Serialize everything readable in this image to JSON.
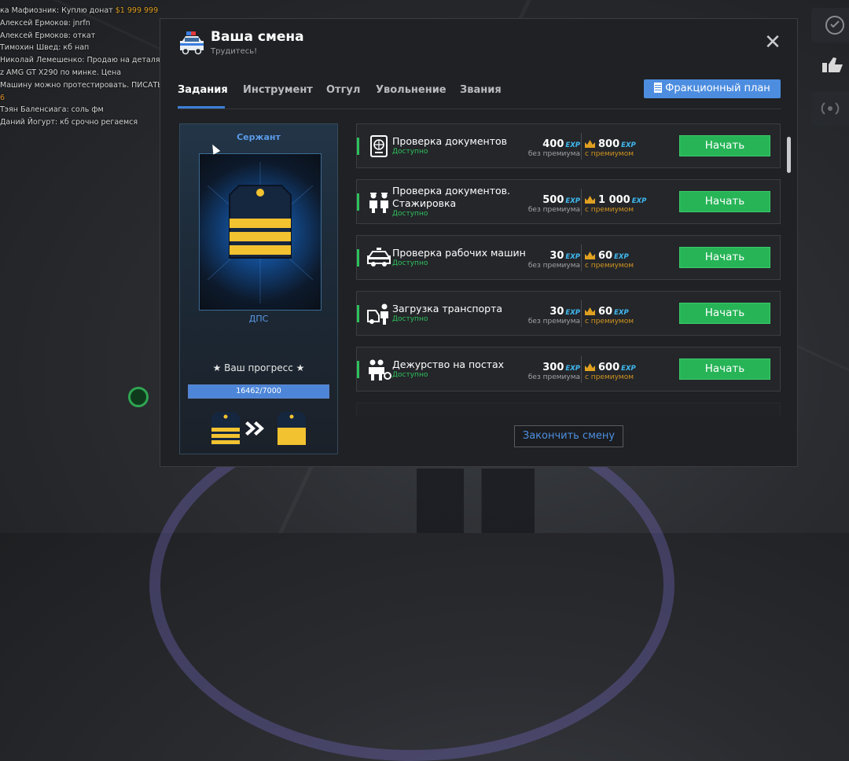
{
  "chat": [
    {
      "prefix": "ка Мафиозник: Куплю донат ",
      "money": "$1 999 999",
      "style": "normal"
    },
    {
      "prefix": "Алексей Ермоков: jnrfn",
      "money": "",
      "style": "normal"
    },
    {
      "prefix": "Алексей Ермоков: откат",
      "money": "",
      "style": "normal"
    },
    {
      "prefix": "Тимохин Швед: кб нап",
      "money": "",
      "style": "normal"
    },
    {
      "prefix": "Николай Лемешенко: Продаю на деталях",
      "money": "",
      "style": "normal"
    },
    {
      "prefix": "z AMG GT X290 по минке. Цена",
      "money": "",
      "style": "normal"
    },
    {
      "prefix": "Машину можно протестировать. ПИСАТЬ",
      "money": "",
      "style": "normal"
    },
    {
      "prefix": "6",
      "money": "",
      "style": "orange"
    },
    {
      "prefix": "Тэян Баленсиага: соль фм",
      "money": "",
      "style": "normal"
    },
    {
      "prefix": "Даний Йогурт: кб срочно регаемся",
      "money": "",
      "style": "normal"
    }
  ],
  "header": {
    "title": "Ваша смена",
    "subtitle": "Трудитесь!"
  },
  "tabs": [
    {
      "label": "Задания",
      "active": true
    },
    {
      "label": "Инструмент",
      "active": false
    },
    {
      "label": "Отгул",
      "active": false
    },
    {
      "label": "Увольнение",
      "active": false
    },
    {
      "label": "Звания",
      "active": false
    }
  ],
  "plan_button": "Фракционный план",
  "rank": {
    "title": "Сержант",
    "department": "ДПС",
    "progress_label": "★ Ваш прогресс ★",
    "progress_current": 16462,
    "progress_max": 7000,
    "progress_text": "16462/7000"
  },
  "reward_labels": {
    "base": "без премиума",
    "premium": "с премиумом",
    "exp": "EXP"
  },
  "tasks": [
    {
      "name": "Проверка документов",
      "status": "Доступно",
      "base": "400",
      "premium": "800",
      "button": "Начать",
      "icon": "passport-icon"
    },
    {
      "name": "Проверка документов. Стажировка",
      "status": "Доступно",
      "base": "500",
      "premium": "1 000",
      "button": "Начать",
      "icon": "officers-icon"
    },
    {
      "name": "Проверка рабочих машин",
      "status": "Доступно",
      "base": "30",
      "premium": "60",
      "button": "Начать",
      "icon": "police-car-icon"
    },
    {
      "name": "Загрузка транспорта",
      "status": "Доступно",
      "base": "30",
      "premium": "60",
      "button": "Начать",
      "icon": "tow-officer-icon"
    },
    {
      "name": "Дежурство на постах",
      "status": "Доступно",
      "base": "300",
      "premium": "600",
      "button": "Начать",
      "icon": "patrol-post-icon"
    }
  ],
  "end_button": "Закончить смену",
  "colors": {
    "accent": "#3d7fd6",
    "start_button": "#27b457",
    "available": "#2fc15c",
    "exp": "#3fb8f0",
    "premium": "#d29520",
    "rank_stripe": "#f2c230"
  }
}
